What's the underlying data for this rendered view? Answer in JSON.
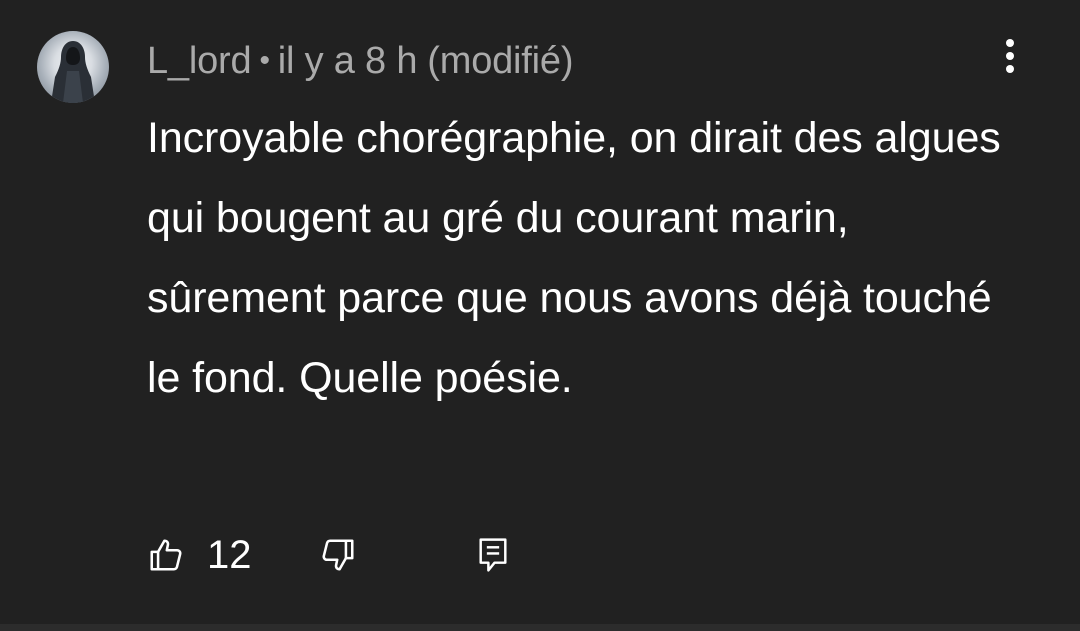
{
  "comment": {
    "author": "L_lord",
    "separator": "•",
    "time": "il y a 8 h",
    "edited": "(modifié)",
    "text": "Incroyable chorégraphie, on dirait des algues qui bougent au gré du courant marin, sûrement parce que nous avons déjà touché le fond. Quelle poésie.",
    "like_count": "12"
  },
  "icons": {
    "avatar": "hooded-figure-avatar",
    "menu": "more-vertical-icon",
    "like": "thumbs-up-icon",
    "dislike": "thumbs-down-icon",
    "reply": "reply-comment-icon"
  },
  "colors": {
    "background": "#212121",
    "primary_text": "#ffffff",
    "secondary_text": "#aaaaaa"
  }
}
